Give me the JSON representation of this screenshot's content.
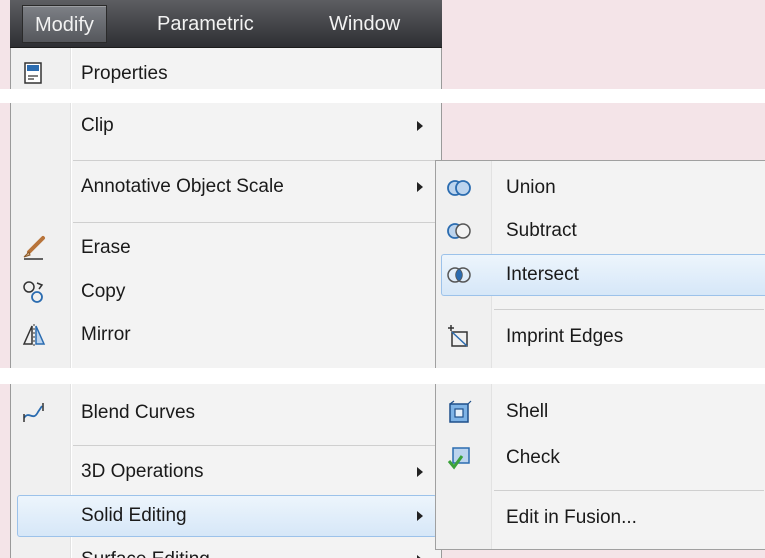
{
  "menubar": {
    "items": [
      "Modify",
      "Parametric",
      "Window"
    ]
  },
  "menu": {
    "items": [
      {
        "label": "Properties",
        "icon": "properties-icon"
      },
      {
        "label": "Clip",
        "submenu": true
      },
      {
        "label": "Annotative Object Scale",
        "submenu": true
      },
      {
        "label": "Erase",
        "icon": "erase-icon"
      },
      {
        "label": "Copy",
        "icon": "copy-icon"
      },
      {
        "label": "Mirror",
        "icon": "mirror-icon"
      },
      {
        "label": "Blend Curves",
        "icon": "blend-curves-icon"
      },
      {
        "label": "3D Operations",
        "submenu": true
      },
      {
        "label": "Solid Editing",
        "submenu": true,
        "highlighted": true
      },
      {
        "label": "Surface Editing",
        "submenu": true
      }
    ]
  },
  "submenu": {
    "items": [
      {
        "label": "Union",
        "icon": "union-icon"
      },
      {
        "label": "Subtract",
        "icon": "subtract-icon"
      },
      {
        "label": "Intersect",
        "icon": "intersect-icon",
        "highlighted": true
      },
      {
        "label": "Imprint Edges",
        "icon": "imprint-edges-icon"
      },
      {
        "label": "Shell",
        "icon": "shell-icon"
      },
      {
        "label": "Check",
        "icon": "check-icon"
      },
      {
        "label": "Edit in Fusion..."
      }
    ]
  },
  "colors": {
    "menubar_bg": "#3c3d41",
    "menu_bg": "#f3f3f3",
    "highlight_border": "#9cc2ea",
    "highlight_bg": "#d6e7f8",
    "icon_blue": "#2b6cb0"
  }
}
